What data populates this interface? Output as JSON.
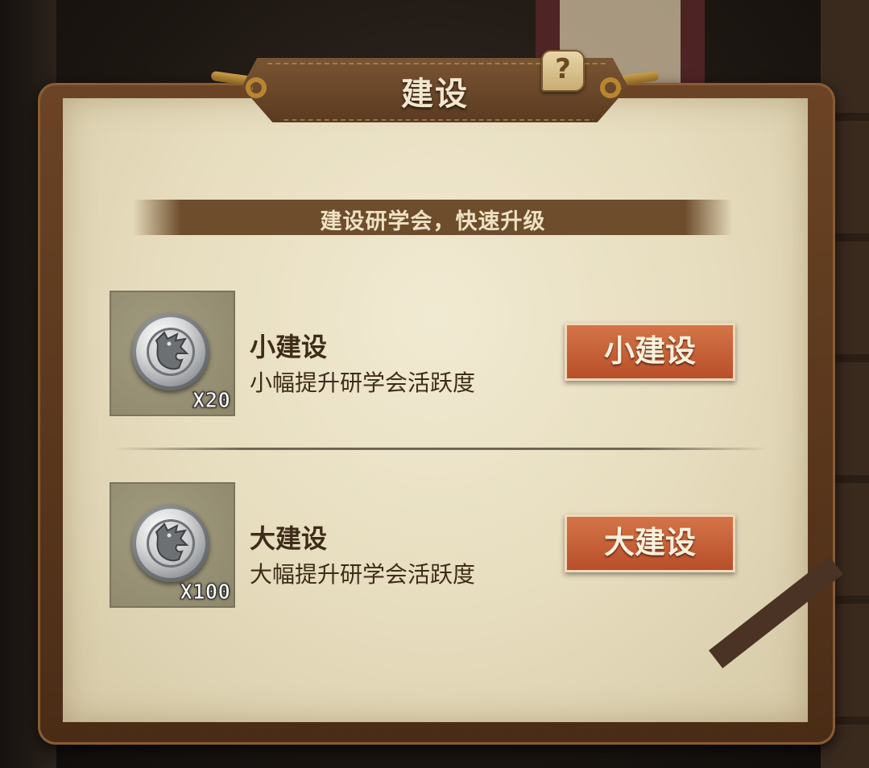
{
  "dialog": {
    "title": "建设",
    "help_symbol": "?",
    "subtitle": "建设研学会，快速升级"
  },
  "options": [
    {
      "name": "小建设",
      "description": "小幅提升研学会活跃度",
      "cost_quantity": "X20",
      "button_label": "小建设",
      "item_icon": "silver-wolf-coin-icon"
    },
    {
      "name": "大建设",
      "description": "大幅提升研学会活跃度",
      "cost_quantity": "X100",
      "button_label": "大建设",
      "item_icon": "silver-wolf-coin-icon"
    }
  ],
  "colors": {
    "button": "#c45e36",
    "paper": "#ece3c8",
    "frame": "#5a3a20"
  }
}
